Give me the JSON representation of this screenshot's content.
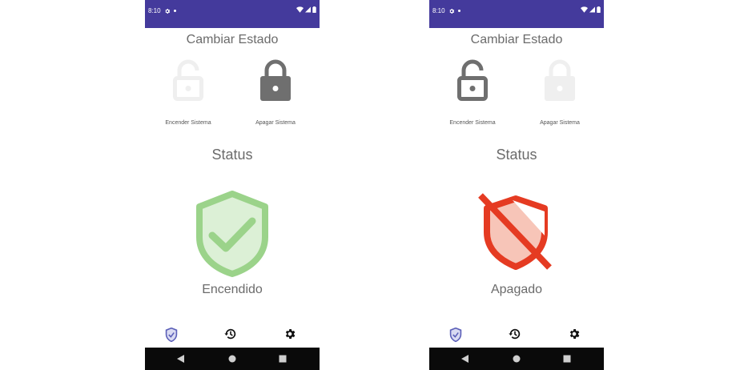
{
  "colors": {
    "status_bar": "#443a9c",
    "text": "#6b6b6b",
    "lock_active": "#6f6f6f",
    "lock_inactive": "#efefef",
    "shield_green": "#9bd38a",
    "shield_green_fill": "#dcf0d6",
    "shield_red": "#e53b22",
    "shield_red_fill": "#f7c5b8",
    "nav_active": "#5b5fb8",
    "android_bar": "#0a0a0a"
  },
  "screens": [
    {
      "status_bar": {
        "time": "8:10"
      },
      "section_title": "Cambiar Estado",
      "lock_on": {
        "label": "Encender Sistema",
        "icon": "lock-open-icon",
        "active": false
      },
      "lock_off": {
        "label": "Apagar Sistema",
        "icon": "lock-closed-icon",
        "active": true
      },
      "status_title": "Status",
      "state_icon": "shield-check-icon",
      "state_text": "Encendido",
      "bottom_nav": [
        "shield-icon",
        "history-icon",
        "settings-icon"
      ]
    },
    {
      "status_bar": {
        "time": "8:10"
      },
      "section_title": "Cambiar Estado",
      "lock_on": {
        "label": "Encender Sistema",
        "icon": "lock-open-icon",
        "active": true
      },
      "lock_off": {
        "label": "Apagar Sistema",
        "icon": "lock-closed-icon",
        "active": false
      },
      "status_title": "Status",
      "state_icon": "shield-off-icon",
      "state_text": "Apagado",
      "bottom_nav": [
        "shield-icon",
        "history-icon",
        "settings-icon"
      ]
    }
  ]
}
